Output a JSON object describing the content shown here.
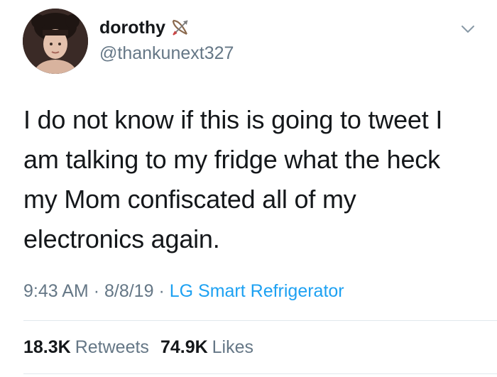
{
  "author": {
    "display_name": "dorothy",
    "handle": "@thankunext327",
    "name_emoji": "bow-and-arrow-icon",
    "avatar": "profile-photo"
  },
  "tweet": {
    "text": "I do not know if this is going to tweet I am talking to my fridge what the heck my Mom confiscated all of my electronics again."
  },
  "meta": {
    "time": "9:43 AM",
    "separator": "·",
    "date": "8/8/19",
    "source": "LG Smart Refrigerator"
  },
  "stats": {
    "retweets_count": "18.3K",
    "retweets_label": "Retweets",
    "likes_count": "74.9K",
    "likes_label": "Likes"
  },
  "colors": {
    "text": "#14171a",
    "secondary": "#657786",
    "link": "#1da1f2",
    "divider": "#e1e8ed"
  }
}
